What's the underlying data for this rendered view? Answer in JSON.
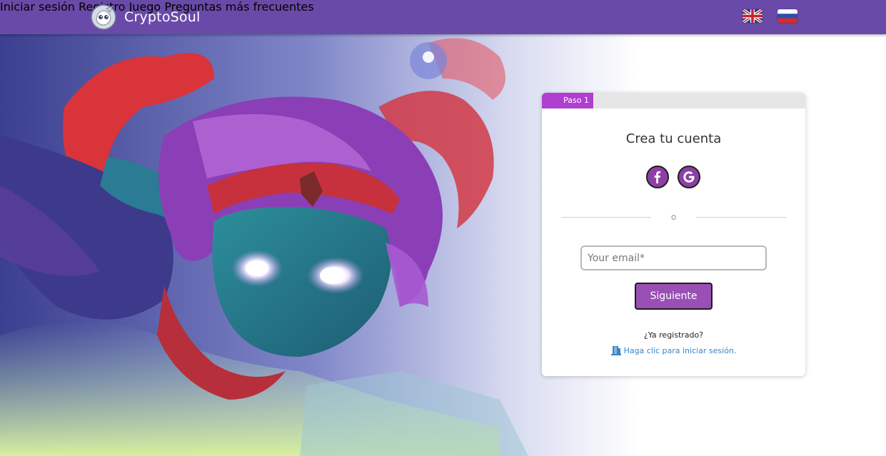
{
  "header": {
    "brand_name": "CryptoSoul",
    "nav": {
      "login": "Iniciar sesión",
      "register": "Registro",
      "game": "Juego",
      "faq": "Preguntas más frecuentes"
    },
    "languages": [
      "en-flag-icon",
      "ru-flag-icon"
    ]
  },
  "signup_card": {
    "step_label": "Paso 1",
    "title": "Crea tu cuenta",
    "social_icons": [
      "facebook-icon",
      "google-icon"
    ],
    "divider_text": "o",
    "email_placeholder": "Your email*",
    "email_value": "",
    "next_button": "Siguiente",
    "already_registered": "¿Ya registrado?",
    "login_link": "Haga clic para iniciar sesión."
  },
  "colors": {
    "header_bg": "#6a4aa8",
    "step_accent": "#b03fd0",
    "button_bg": "#9a4fb4",
    "social_bg": "#8e3fa5",
    "link": "#3a84c4"
  }
}
